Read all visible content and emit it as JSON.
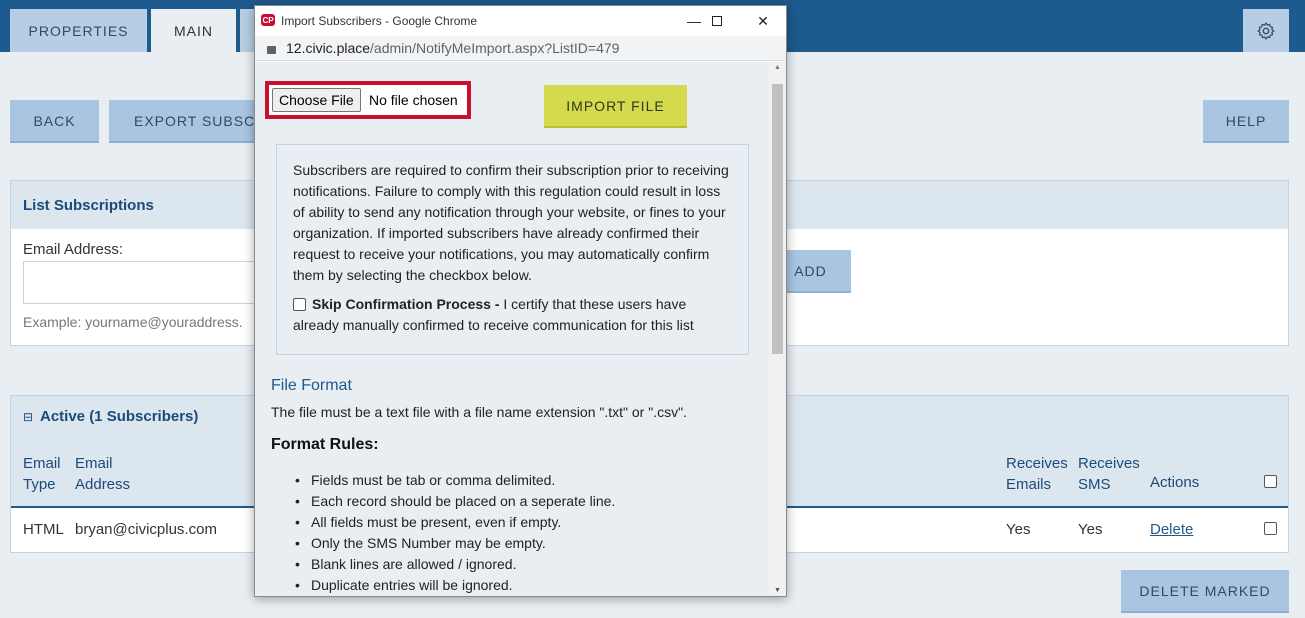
{
  "tabs": {
    "properties": "PROPERTIES",
    "main": "MAIN"
  },
  "toolbar": {
    "back": "BACK",
    "export": "EXPORT SUBSCR",
    "help": "HELP"
  },
  "list_subscriptions": {
    "title": "List Subscriptions",
    "email_label": "Email Address:",
    "example": "Example: yourname@youraddress.",
    "add": "ADD"
  },
  "active": {
    "title": "Active (1 Subscribers)",
    "headers": {
      "email_type": [
        "Email",
        "Type"
      ],
      "email_address": [
        "Email",
        "Address"
      ],
      "receives_emails": [
        "Receives",
        "Emails"
      ],
      "receives_sms": [
        "Receives",
        "SMS"
      ],
      "actions": "Actions"
    },
    "row": {
      "type": "HTML",
      "address": "bryan@civicplus.com",
      "emails": "Yes",
      "sms": "Yes",
      "action": "Delete"
    }
  },
  "delete_marked": "DELETE MARKED",
  "popup": {
    "window_title": "Import Subscribers - Google Chrome",
    "url_host": "12.civic.place",
    "url_path": "/admin/NotifyMeImport.aspx?ListID=479",
    "choose_file": "Choose File",
    "no_file": "No file chosen",
    "import_file": "IMPORT FILE",
    "notice": "Subscribers are required to confirm their subscription prior to receiving notifications. Failure to comply with this regulation could result in loss of ability to send any notification through your website, or fines to your organization. If imported subscribers have already confirmed their request to receive your notifications, you may automatically confirm them by selecting the checkbox below.",
    "skip_label": "Skip Confirmation Process -",
    "skip_text": " I certify that these users have already manually confirmed to receive communication for this list",
    "file_format_title": "File Format",
    "file_format_desc": "The file must be a text file with a file name extension \".txt\" or \".csv\".",
    "format_rules_title": "Format Rules:",
    "rules": [
      "Fields must be tab or comma delimited.",
      "Each record should be placed on a seperate line.",
      "All fields must be present, even if empty.",
      "Only the SMS Number may be empty.",
      "Blank lines are allowed / ignored.",
      "Duplicate entries will be ignored."
    ]
  }
}
